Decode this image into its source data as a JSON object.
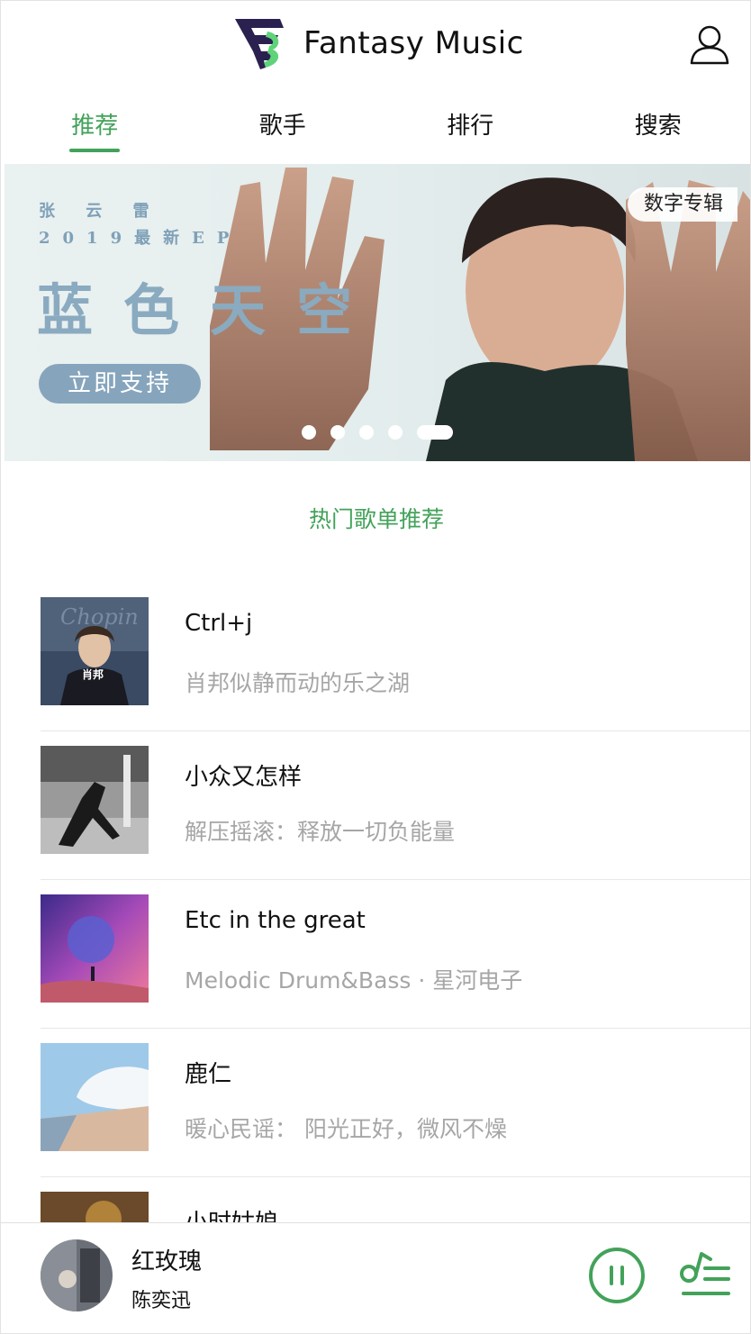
{
  "app": {
    "name": "Fantasy Music"
  },
  "tabs": [
    {
      "label": "推荐",
      "active": true
    },
    {
      "label": "歌手",
      "active": false
    },
    {
      "label": "排行",
      "active": false
    },
    {
      "label": "搜索",
      "active": false
    }
  ],
  "banner": {
    "artist": "张 云 雷",
    "subtitle": "2019最新EP",
    "title": "蓝色天空",
    "cta": "立即支持",
    "tag": "数字专辑",
    "slide_count": 5,
    "active_slide": 5
  },
  "section": {
    "title": "热门歌单推荐"
  },
  "playlists": [
    {
      "title": "Ctrl+j",
      "desc": "肖邦似静而动的乐之湖",
      "cover_text": "肖邦",
      "cover_script": "Chopin",
      "cover": "portrait"
    },
    {
      "title": "小众又怎样",
      "desc": "解压摇滚：释放一切负能量",
      "cover": "rock"
    },
    {
      "title": "Etc in the great",
      "desc": "Melodic Drum&Bass · 星河电子",
      "cover": "galaxy"
    },
    {
      "title": "鹿仁",
      "desc": "暖心民谣： 阳光正好，微风不燥",
      "cover": "sky"
    },
    {
      "title": "小时姑娘",
      "desc": "",
      "cover": "painting"
    }
  ],
  "player": {
    "title": "红玫瑰",
    "artist": "陈奕迅",
    "state": "playing"
  },
  "colors": {
    "accent": "#43a25a",
    "banner_text": "#8aaac0",
    "logo_dark": "#2b2150",
    "logo_green": "#5ed37a"
  },
  "icons": {
    "user": "user-icon",
    "pause": "pause-icon",
    "playlist": "playlist-icon",
    "logo": "logo-icon"
  }
}
